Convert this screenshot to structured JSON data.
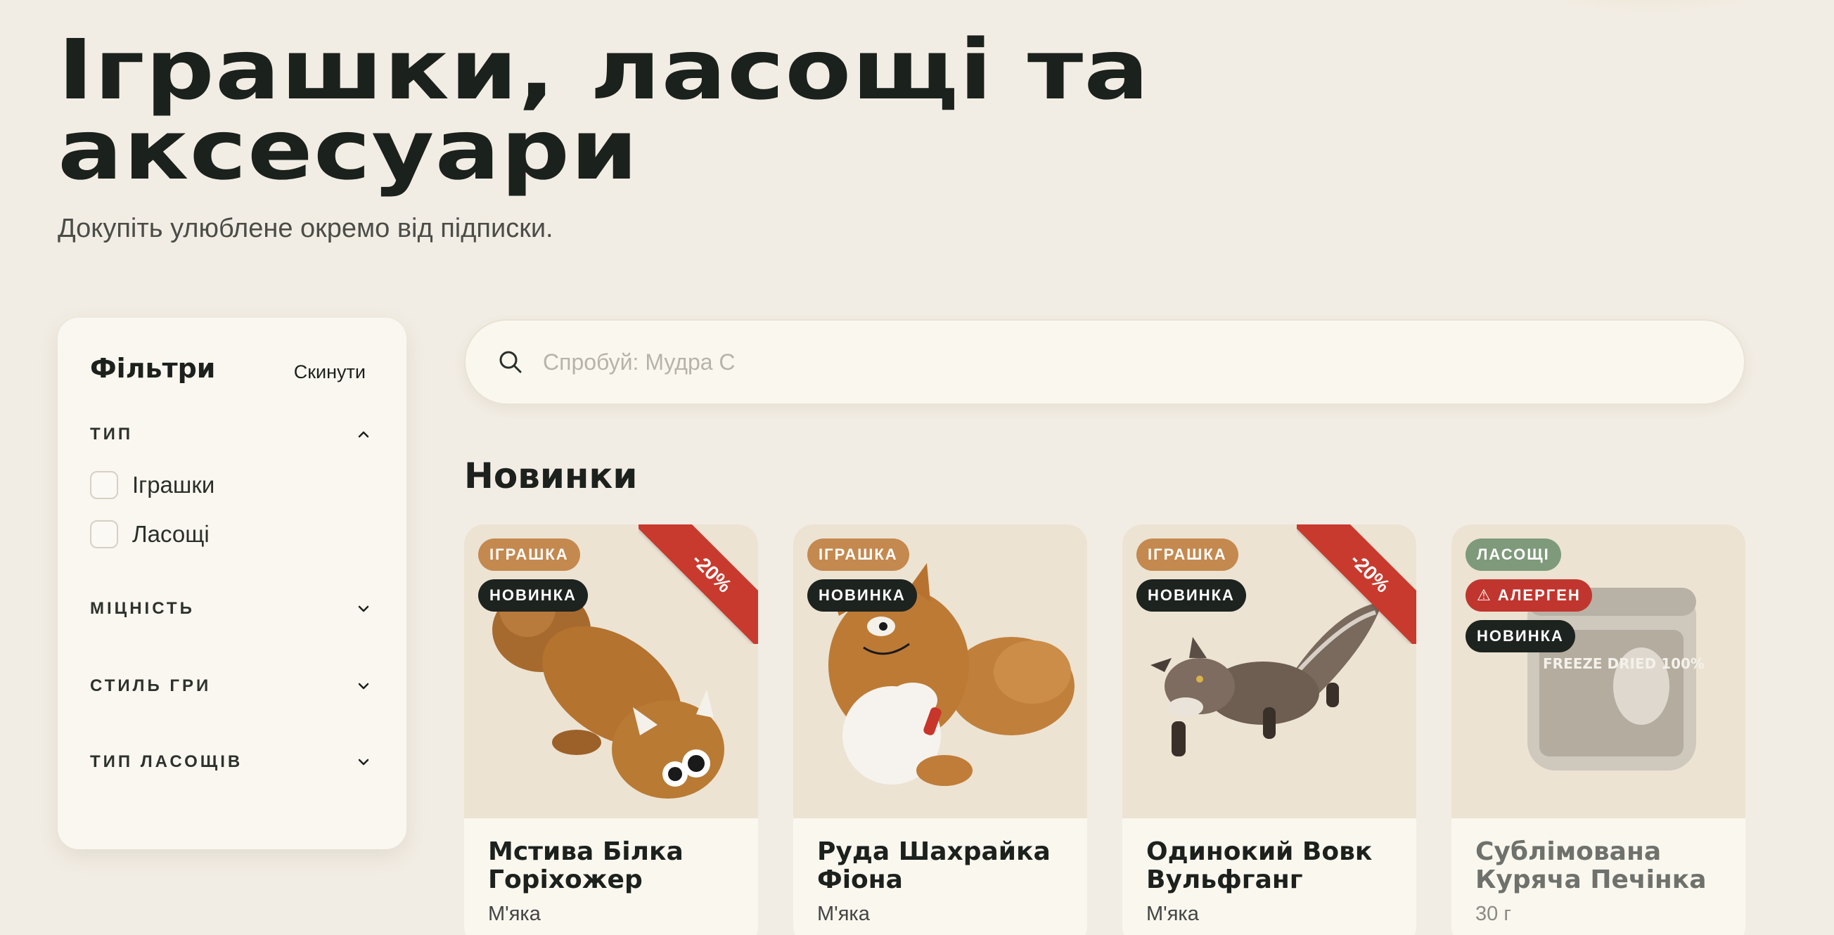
{
  "hero": {
    "title": "Іграшки, ласощі та аксесуари",
    "subtitle": "Докупіть улюблене окремо від підписки."
  },
  "filters": {
    "title": "Фільтри",
    "reset_label": "Скинути",
    "groups": [
      {
        "label": "ТИП",
        "expanded": true,
        "options": [
          "Іграшки",
          "Ласощі"
        ]
      },
      {
        "label": "МІЦНІСТЬ",
        "expanded": false
      },
      {
        "label": "СТИЛЬ ГРИ",
        "expanded": false
      },
      {
        "label": "ТИП ЛАСОЩІВ",
        "expanded": false
      }
    ]
  },
  "search": {
    "placeholder": "Спробуй: Мудра С",
    "icon": "search-icon"
  },
  "section": {
    "title": "Новинки"
  },
  "products": [
    {
      "name": "Мстива Білка Горіхожер",
      "sub": "М'яка",
      "badges": [
        "ІГРАШКА",
        "НОВИНКА"
      ],
      "discount": "-20%"
    },
    {
      "name": "Руда Шахрайка Фіона",
      "sub": "М'яка",
      "badges": [
        "ІГРАШКА",
        "НОВИНКА"
      ],
      "discount": ""
    },
    {
      "name": "Одинокий Вовк Вульфганг",
      "sub": "М'яка",
      "badges": [
        "ІГРАШКА",
        "НОВИНКА"
      ],
      "discount": "-20%"
    },
    {
      "name": "Сублімована Куряча Печінка",
      "sub": "30 г",
      "badges": [
        "ЛАСОЩІ",
        "⚠ АЛЕРГЕН",
        "НОВИНКА"
      ],
      "discount": "",
      "jar_label": "FREEZE DRIED 100%"
    }
  ],
  "colors": {
    "background": "#f2ede4",
    "toy_badge": "#c4894f",
    "new_badge": "#1d231f",
    "treat_badge": "#7e9a7a",
    "allergen_badge": "#c0362e",
    "discount_ribbon": "#c93a2e"
  }
}
